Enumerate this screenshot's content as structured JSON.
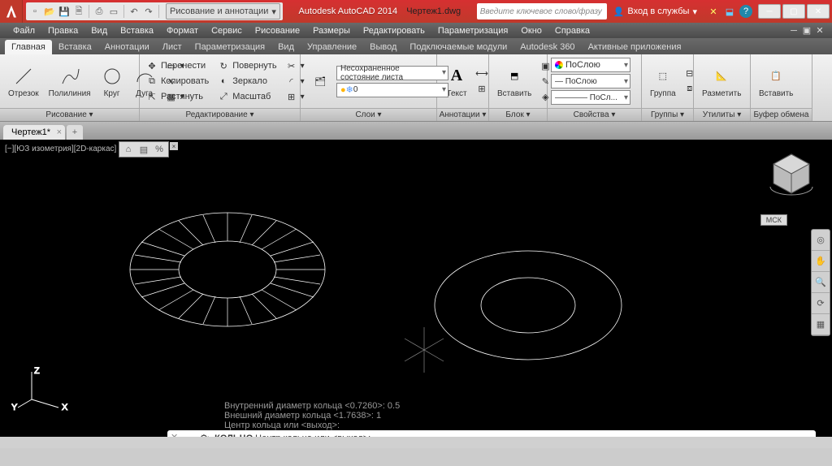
{
  "title": {
    "app": "Autodesk AutoCAD 2014",
    "doc": "Чертеж1.dwg"
  },
  "workspace": "Рисование и аннотации",
  "search_placeholder": "Введите ключевое слово/фразу",
  "signin": "Вход в службы",
  "menu": [
    "Файл",
    "Правка",
    "Вид",
    "Вставка",
    "Формат",
    "Сервис",
    "Рисование",
    "Размеры",
    "Редактировать",
    "Параметризация",
    "Окно",
    "Справка"
  ],
  "tabs": [
    "Главная",
    "Вставка",
    "Аннотации",
    "Лист",
    "Параметризация",
    "Вид",
    "Управление",
    "Вывод",
    "Подключаемые модули",
    "Autodesk 360",
    "Активные приложения"
  ],
  "panels": {
    "draw": {
      "title": "Рисование ▾",
      "buttons": {
        "line": "Отрезок",
        "polyline": "Полилиния",
        "circle": "Круг",
        "arc": "Дуга"
      }
    },
    "modify": {
      "title": "Редактирование ▾",
      "rows": {
        "move": "Перенести",
        "rotate": "Повернуть",
        "copy": "Копировать",
        "mirror": "Зеркало",
        "stretch": "Растянуть",
        "scale": "Масштаб"
      }
    },
    "layers": {
      "title": "Слои ▾",
      "combo": "Несохраненное состояние листа"
    },
    "annotation": {
      "title": "Аннотации ▾",
      "text": "Текст"
    },
    "block": {
      "title": "Блок ▾",
      "insert": "Вставить"
    },
    "properties": {
      "title": "Свойства ▾",
      "bylayer": "ПоСлою",
      "bylayer2": "— ПоСлою",
      "bylayer3": "———— ПоСл..."
    },
    "groups": {
      "title": "Группы ▾",
      "group": "Группа"
    },
    "utilities": {
      "title": "Утилиты ▾",
      "measure": "Разметить"
    },
    "clipboard": {
      "title": "Буфер обмена",
      "paste": "Вставить"
    }
  },
  "doctab": "Чертеж1*",
  "viewlabel": "[−][ЮЗ изометрия][2D-каркас]",
  "mck": "МСК",
  "cmd_history": [
    "Внутренний диаметр кольца <0.7260>: 0.5",
    "Внешний диаметр кольца <1.7638>: 1",
    "Центр кольца или <выход>:"
  ],
  "cmd": {
    "command": "КОЛЬЦО",
    "prompt": "Центр кольца или <выход>:"
  },
  "ucs": {
    "x": "X",
    "y": "Y",
    "z": "Z"
  }
}
